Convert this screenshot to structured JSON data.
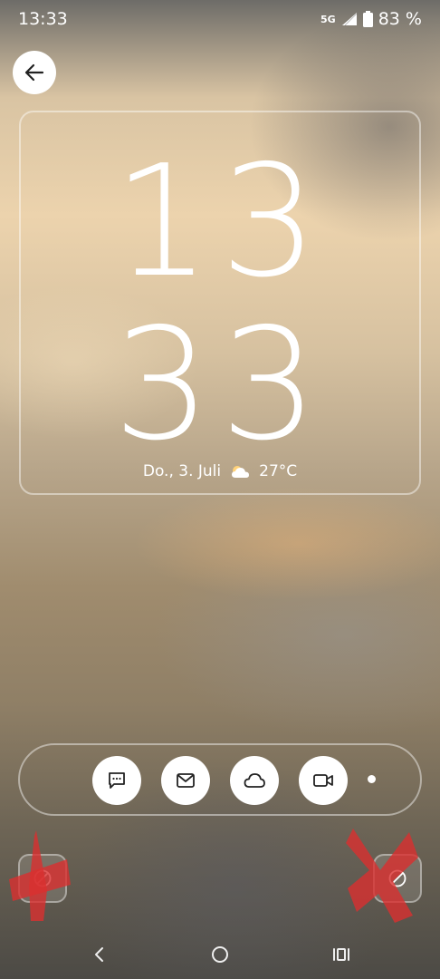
{
  "status_bar": {
    "time": "13:33",
    "network": "5G",
    "battery": "83 %"
  },
  "clock": {
    "hours": "13",
    "minutes": "33",
    "date": "Do., 3. Juli",
    "temperature": "27°C",
    "weather_icon": "partly-cloudy-icon"
  },
  "shortcuts": [
    {
      "name": "messages",
      "icon": "message-icon"
    },
    {
      "name": "email",
      "icon": "mail-icon"
    },
    {
      "name": "cloud",
      "icon": "cloud-icon"
    },
    {
      "name": "video",
      "icon": "video-camera-icon"
    }
  ],
  "corner_shortcuts": [
    {
      "name": "left",
      "icon": "disabled-icon"
    },
    {
      "name": "right",
      "icon": "disabled-icon"
    }
  ],
  "navigation": [
    "back",
    "home",
    "recents"
  ],
  "colors": {
    "icon_dark": "#222222",
    "red_mark": "#d93030"
  }
}
